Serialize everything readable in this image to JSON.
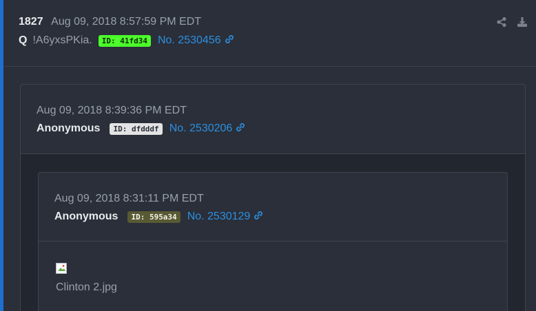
{
  "post": {
    "number": "1827",
    "timestamp": "Aug 09, 2018 8:57:59 PM EDT",
    "author": "Q",
    "tripcode": "!A6yxsPKia.",
    "id_badge": "ID: 41fd34",
    "post_link": "No. 2530456",
    "actions": [
      "share-icon",
      "download-icon"
    ]
  },
  "reply1": {
    "timestamp": "Aug 09, 2018 8:39:36 PM EDT",
    "author": "Anonymous",
    "id_badge": "ID: dfdddf",
    "post_link": "No. 2530206"
  },
  "reply2": {
    "timestamp": "Aug 09, 2018 8:31:11 PM EDT",
    "author": "Anonymous",
    "id_badge": "ID: 595a34",
    "post_link": "No. 2530129",
    "image_filename": "Clinton 2.jpg"
  },
  "colors": {
    "accent_link": "#2d8fe0",
    "left_bar": "#1f6fcf",
    "badge_q": "#4cff2a",
    "badge_reply1": "#e3e3e3",
    "badge_reply2": "#595a34"
  }
}
